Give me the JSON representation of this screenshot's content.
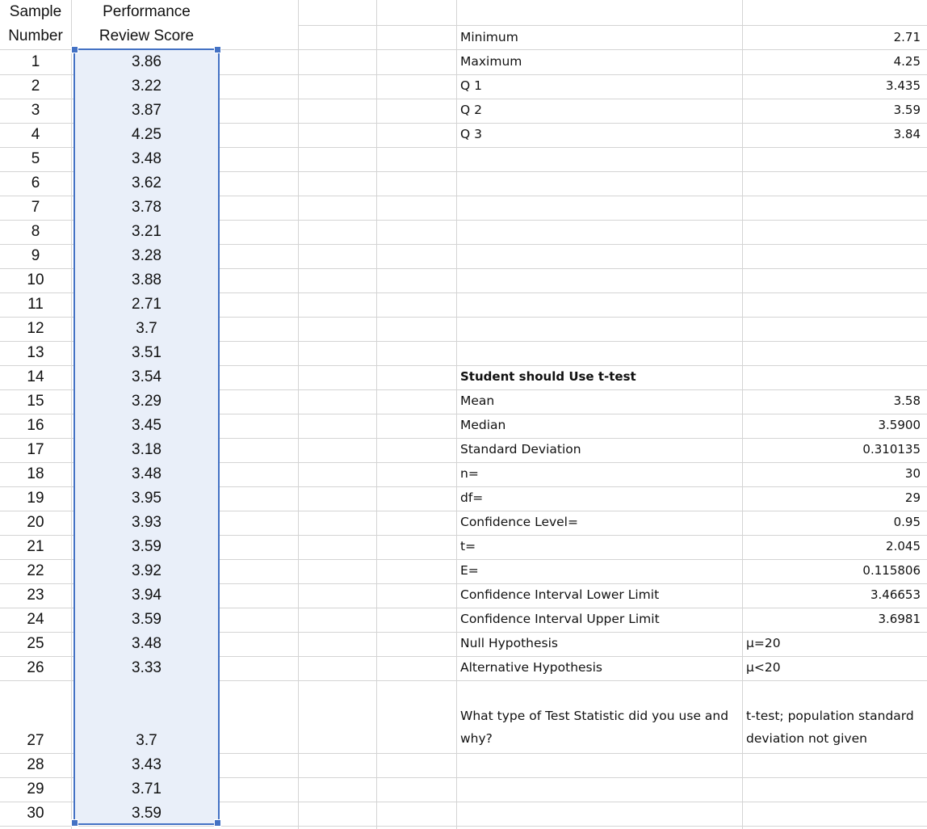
{
  "left_table": {
    "header_col1": [
      "Sample",
      "Number"
    ],
    "header_col2": [
      "Performance",
      "Review Score"
    ],
    "rows": [
      {
        "n": "1",
        "score": "3.86"
      },
      {
        "n": "2",
        "score": "3.22"
      },
      {
        "n": "3",
        "score": "3.87"
      },
      {
        "n": "4",
        "score": "4.25"
      },
      {
        "n": "5",
        "score": "3.48"
      },
      {
        "n": "6",
        "score": "3.62"
      },
      {
        "n": "7",
        "score": "3.78"
      },
      {
        "n": "8",
        "score": "3.21"
      },
      {
        "n": "9",
        "score": "3.28"
      },
      {
        "n": "10",
        "score": "3.88"
      },
      {
        "n": "11",
        "score": "2.71"
      },
      {
        "n": "12",
        "score": "3.7"
      },
      {
        "n": "13",
        "score": "3.51"
      },
      {
        "n": "14",
        "score": "3.54"
      },
      {
        "n": "15",
        "score": "3.29"
      },
      {
        "n": "16",
        "score": "3.45"
      },
      {
        "n": "17",
        "score": "3.18"
      },
      {
        "n": "18",
        "score": "3.48"
      },
      {
        "n": "19",
        "score": "3.95"
      },
      {
        "n": "20",
        "score": "3.93"
      },
      {
        "n": "21",
        "score": "3.59"
      },
      {
        "n": "22",
        "score": "3.92"
      },
      {
        "n": "23",
        "score": "3.94"
      },
      {
        "n": "24",
        "score": "3.59"
      },
      {
        "n": "25",
        "score": "3.48"
      },
      {
        "n": "26",
        "score": "3.33"
      },
      {
        "n": "27",
        "score": "3.7"
      },
      {
        "n": "28",
        "score": "3.43"
      },
      {
        "n": "29",
        "score": "3.71"
      },
      {
        "n": "30",
        "score": "3.59"
      }
    ]
  },
  "summary": [
    {
      "label": "Minimum",
      "value": "2.71"
    },
    {
      "label": "Maximum",
      "value": "4.25"
    },
    {
      "label": "Q 1",
      "value": "3.435"
    },
    {
      "label": "Q 2",
      "value": "3.59"
    },
    {
      "label": "Q 3",
      "value": "3.84"
    }
  ],
  "ttest_heading": "Student should Use t-test",
  "ttest": [
    {
      "label": "Mean",
      "value": "3.58"
    },
    {
      "label": "Median",
      "value": "3.5900"
    },
    {
      "label": "Standard Deviation",
      "value": "0.310135"
    },
    {
      "label": "n=",
      "value": "30"
    },
    {
      "label": "df=",
      "value": "29"
    },
    {
      "label": "Confidence Level=",
      "value": "0.95"
    },
    {
      "label": "t=",
      "value": "2.045"
    },
    {
      "label": "E=",
      "value": "0.115806"
    },
    {
      "label": "Confidence Interval Lower Limit",
      "value": "3.46653"
    },
    {
      "label": "Confidence Interval Upper Limit",
      "value": "3.6981"
    }
  ],
  "hypotheses": [
    {
      "label": "Null Hypothesis",
      "value": "μ=20"
    },
    {
      "label": "Alternative Hypothesis",
      "value": "μ<20"
    }
  ],
  "question": [
    "What type of Test Statistic did you use and",
    "why?"
  ],
  "answer": [
    "t-test; population standard",
    "deviation not given"
  ],
  "colors": {
    "selection_border": "#4472c4",
    "selection_fill": "#e9eff9",
    "gridline": "#d4d4d4"
  }
}
